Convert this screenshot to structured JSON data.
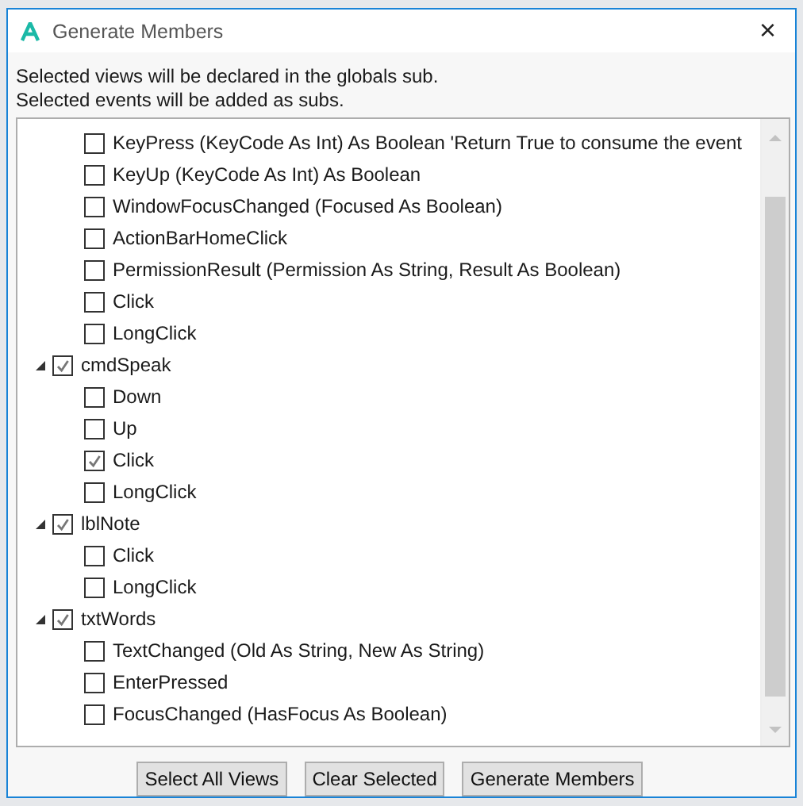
{
  "window": {
    "title": "Generate Members",
    "close": "×"
  },
  "info": [
    "Selected views will be declared in the globals sub.",
    "Selected events will be added as subs."
  ],
  "tree": [
    {
      "children": [
        {
          "label": "KeyPress (KeyCode As Int) As Boolean 'Return True to consume the event",
          "checked": false
        },
        {
          "label": "KeyUp (KeyCode As Int) As Boolean",
          "checked": false
        },
        {
          "label": "WindowFocusChanged (Focused As Boolean)",
          "checked": false
        },
        {
          "label": "ActionBarHomeClick",
          "checked": false
        },
        {
          "label": "PermissionResult (Permission As String, Result As Boolean)",
          "checked": false
        },
        {
          "label": "Click",
          "checked": false
        },
        {
          "label": "LongClick",
          "checked": false
        }
      ]
    },
    {
      "label": "cmdSpeak",
      "checked": true,
      "expanded": true,
      "children": [
        {
          "label": "Down",
          "checked": false
        },
        {
          "label": "Up",
          "checked": false
        },
        {
          "label": "Click",
          "checked": true
        },
        {
          "label": "LongClick",
          "checked": false
        }
      ]
    },
    {
      "label": "lblNote",
      "checked": true,
      "expanded": true,
      "children": [
        {
          "label": "Click",
          "checked": false
        },
        {
          "label": "LongClick",
          "checked": false
        }
      ]
    },
    {
      "label": "txtWords",
      "checked": true,
      "expanded": true,
      "children": [
        {
          "label": "TextChanged (Old As String, New As String)",
          "checked": false
        },
        {
          "label": "EnterPressed",
          "checked": false
        },
        {
          "label": "FocusChanged (HasFocus As Boolean)",
          "checked": false
        }
      ]
    }
  ],
  "buttons": [
    "Select All Views",
    "Clear Selected",
    "Generate Members"
  ]
}
